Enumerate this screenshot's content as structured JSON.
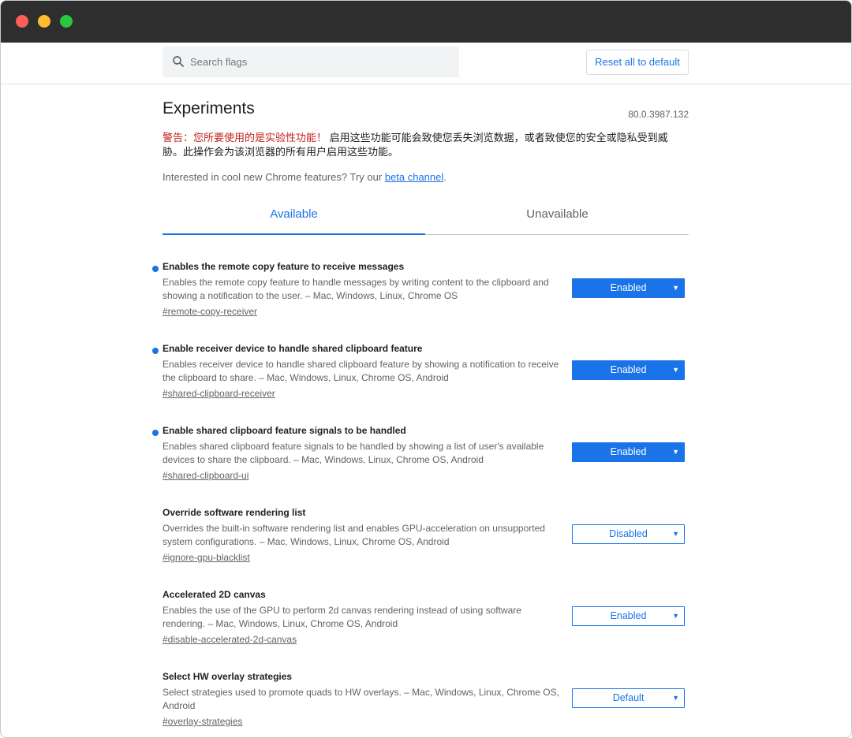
{
  "header": {
    "search_placeholder": "Search flags",
    "reset_label": "Reset all to default"
  },
  "page": {
    "title": "Experiments",
    "version": "80.0.3987.132",
    "warning_red": "警告：您所要使用的是实验性功能！",
    "warning_rest": "启用这些功能可能会致使您丢失浏览数据，或者致使您的安全或隐私受到威胁。此操作会为该浏览器的所有用户启用这些功能。",
    "interested_text": "Interested in cool new Chrome features? Try our ",
    "interested_link": "beta channel",
    "interested_suffix": "."
  },
  "tabs": [
    {
      "label": "Available",
      "active": true
    },
    {
      "label": "Unavailable",
      "active": false
    }
  ],
  "colors": {
    "accent": "#1a73e8",
    "warning": "#c5221f",
    "titlebar": "#2e2e2e"
  },
  "flags": [
    {
      "title": "Enables the remote copy feature to receive messages",
      "desc": "Enables the remote copy feature to handle messages by writing content to the clipboard and showing a notification to the user. – Mac, Windows, Linux, Chrome OS",
      "link": "#remote-copy-receiver",
      "value": "Enabled",
      "modified": true
    },
    {
      "title": "Enable receiver device to handle shared clipboard feature",
      "desc": "Enables receiver device to handle shared clipboard feature by showing a notification to receive the clipboard to share. – Mac, Windows, Linux, Chrome OS, Android",
      "link": "#shared-clipboard-receiver",
      "value": "Enabled",
      "modified": true
    },
    {
      "title": "Enable shared clipboard feature signals to be handled",
      "desc": "Enables shared clipboard feature signals to be handled by showing a list of user's available devices to share the clipboard. – Mac, Windows, Linux, Chrome OS, Android",
      "link": "#shared-clipboard-ui",
      "value": "Enabled",
      "modified": true
    },
    {
      "title": "Override software rendering list",
      "desc": "Overrides the built-in software rendering list and enables GPU-acceleration on unsupported system configurations. – Mac, Windows, Linux, Chrome OS, Android",
      "link": "#ignore-gpu-blacklist",
      "value": "Disabled",
      "modified": false
    },
    {
      "title": "Accelerated 2D canvas",
      "desc": "Enables the use of the GPU to perform 2d canvas rendering instead of using software rendering. – Mac, Windows, Linux, Chrome OS, Android",
      "link": "#disable-accelerated-2d-canvas",
      "value": "Enabled",
      "modified": false
    },
    {
      "title": "Select HW overlay strategies",
      "desc": "Select strategies used to promote quads to HW overlays. – Mac, Windows, Linux, Chrome OS, Android",
      "link": "#overlay-strategies",
      "value": "Default",
      "modified": false
    }
  ]
}
